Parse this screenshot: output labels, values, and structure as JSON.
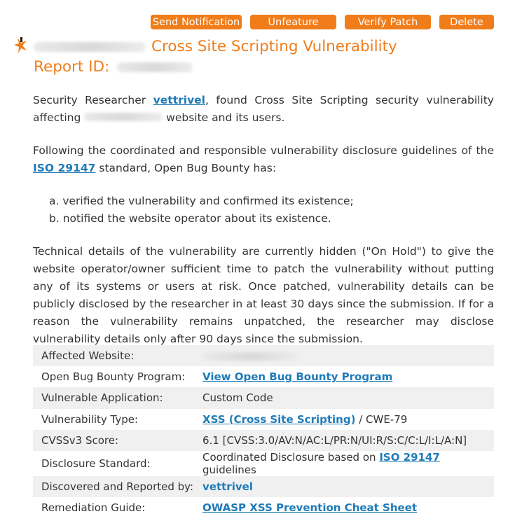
{
  "actions": {
    "send_notification": "Send Notification",
    "unfeature": "Unfeature",
    "verify_patch": "Verify Patch",
    "delete": "Delete"
  },
  "report": {
    "title_suffix": "Cross Site Scripting Vulnerability",
    "report_id_label": "Report ID:",
    "accent_color": "#f07d1a"
  },
  "body": {
    "p1_prefix": "Security Researcher ",
    "researcher": "vettrivel",
    "p1_middle": ", found Cross Site Scripting security vulnerability affecting",
    "p1_suffix": " website and its users.",
    "p2_prefix": "Following the coordinated and responsible vulnerability disclosure guidelines of the ",
    "iso_link": "ISO 29147",
    "p2_suffix": " standard, Open Bug Bounty has:",
    "list_a": "a. verified the vulnerability and confirmed its existence;",
    "list_b": "b. notified the website operator about its existence.",
    "p3": "Technical details of the vulnerability are currently hidden (\"On Hold\") to give the website operator/owner sufficient time to patch the vulnerability without putting any of its systems or users at risk. Once patched, vulnerability details can be publicly disclosed by the researcher in at least 30 days since the submission. If for a reason the vulnerability remains unpatched, the researcher may disclose vulnerability details only after 90 days since the submission."
  },
  "details": {
    "affected_website_label": "Affected Website:",
    "program_label": "Open Bug Bounty Program:",
    "program_value": "View Open Bug Bounty Program",
    "app_label": "Vulnerable Application:",
    "app_value": "Custom Code",
    "type_label": "Vulnerability Type:",
    "type_link": "XSS (Cross Site Scripting)",
    "type_suffix": " / CWE-79",
    "cvss_label": "CVSSv3 Score:",
    "cvss_value": "6.1 [CVSS:3.0/AV:N/AC:L/PR:N/UI:R/S:C/C:L/I:L/A:N]",
    "standard_label": "Disclosure Standard:",
    "standard_prefix": "Coordinated Disclosure based on ",
    "standard_link": "ISO 29147",
    "standard_suffix": " guidelines",
    "reporter_label": "Discovered and Reported by:",
    "reporter_value": "vettrivel",
    "guide_label": "Remediation Guide:",
    "guide_value": "OWASP XSS Prevention Cheat Sheet"
  },
  "icons": {
    "flag": "flag-icon"
  }
}
